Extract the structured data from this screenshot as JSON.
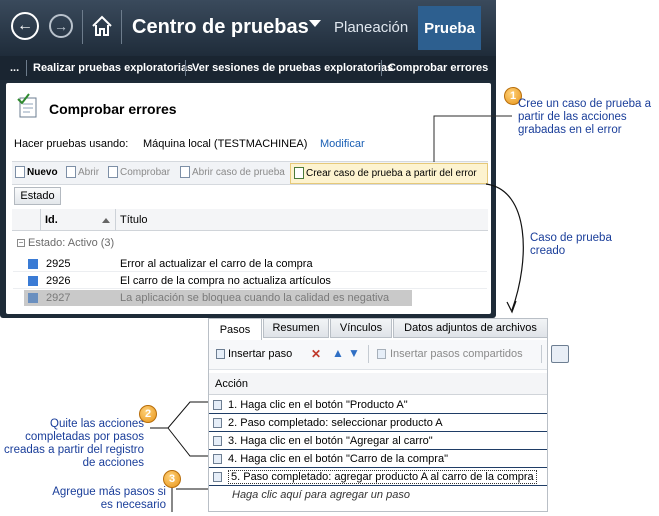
{
  "topbar": {
    "hub_title": "Centro de pruebas",
    "nav_planeacion": "Planeación",
    "nav_prueba": "Prueba"
  },
  "breadcrumbs": {
    "ellipsis": "...",
    "item1": "Realizar pruebas exploratorias",
    "item2": "Ver sesiones de pruebas exploratorias",
    "item3": "Comprobar errores"
  },
  "panel": {
    "title": "Comprobar errores",
    "machine_label": "Hacer pruebas usando:",
    "machine_value": "Máquina local (TESTMACHINEA)",
    "modify_link": "Modificar"
  },
  "toolbar": {
    "nuevo": "Nuevo",
    "abrir": "Abrir",
    "comprobar": "Comprobar",
    "abrir_caso": "Abrir caso de prueba",
    "crear_caso": "Crear caso de prueba a partir del error"
  },
  "grid": {
    "group_button": "Estado",
    "col_id": "Id.",
    "col_title": "Título",
    "group_label": "Estado: Activo (3)",
    "rows": [
      {
        "id": "2925",
        "title": "Error al actualizar el carro de la compra"
      },
      {
        "id": "2926",
        "title": "El carro de la compra no actualiza artículos"
      },
      {
        "id": "2927",
        "title": "La aplicación se bloquea cuando la calidad es negativa"
      }
    ]
  },
  "lower": {
    "tabs": [
      "Pasos",
      "Resumen",
      "Vínculos",
      "Datos adjuntos de archivos"
    ],
    "insert_step": "Insertar paso",
    "insert_shared": "Insertar pasos compartidos",
    "col_action": "Acción",
    "steps": [
      "1. Haga clic en el botón \"Producto A\"",
      "2. Paso completado: seleccionar producto A",
      "3. Haga clic en el botón \"Agregar al carro\"",
      "4. Haga clic en el botón \"Carro de la compra\"",
      "5. Paso completado: agregar producto A al carro de la compra"
    ],
    "add_step_placeholder": "Haga clic aquí para agregar un paso"
  },
  "callouts": {
    "c1_num": "1",
    "c1_text": "Cree un caso de prueba a partir de las acciones grabadas en el error",
    "c2_num": "2",
    "c2_text": "Quite las acciones completadas por pasos creadas a partir del registro de acciones",
    "c3_num": "3",
    "c3_text": "Agregue más pasos si es necesario",
    "created_text": "Caso de prueba creado"
  },
  "colors": {
    "callout_text": "#1a3e9a",
    "selected_tab": "#2d5f8f",
    "link": "#1a5fb4"
  }
}
